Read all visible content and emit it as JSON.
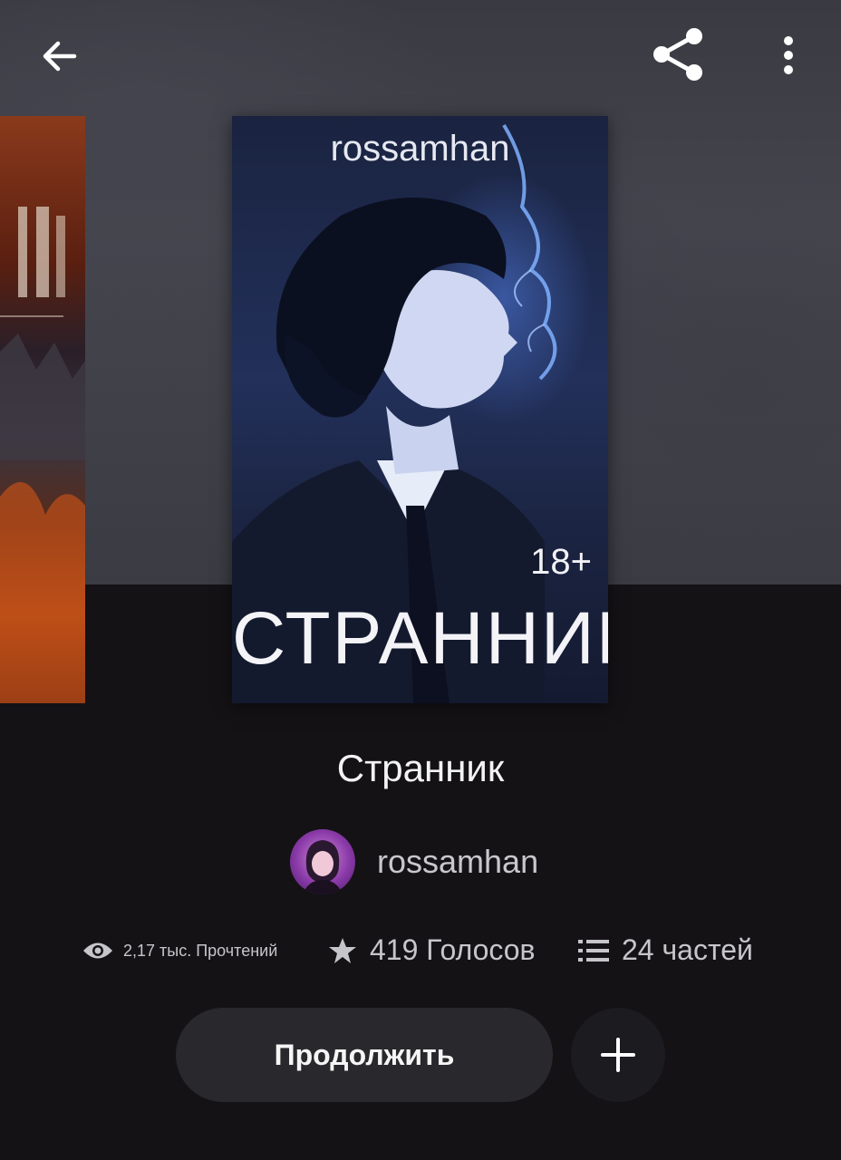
{
  "header": {
    "back_icon": "arrow-left-icon",
    "share_icon": "share-icon",
    "more_icon": "more-vertical-icon"
  },
  "cover": {
    "author_text": "rossamhan",
    "age_rating": "18+",
    "title_text": "СТРАННИК"
  },
  "story": {
    "title": "Странник",
    "author": "rossamhan"
  },
  "stats": {
    "reads": "2,17 тыс. Прочтений",
    "votes": "419 Голосов",
    "parts": "24 частей"
  },
  "actions": {
    "continue_label": "Продолжить",
    "add_icon": "plus-icon"
  },
  "colors": {
    "background": "#141215",
    "hero": "#3d3d45",
    "button": "#29282c",
    "text_secondary": "#c6c6ca"
  }
}
